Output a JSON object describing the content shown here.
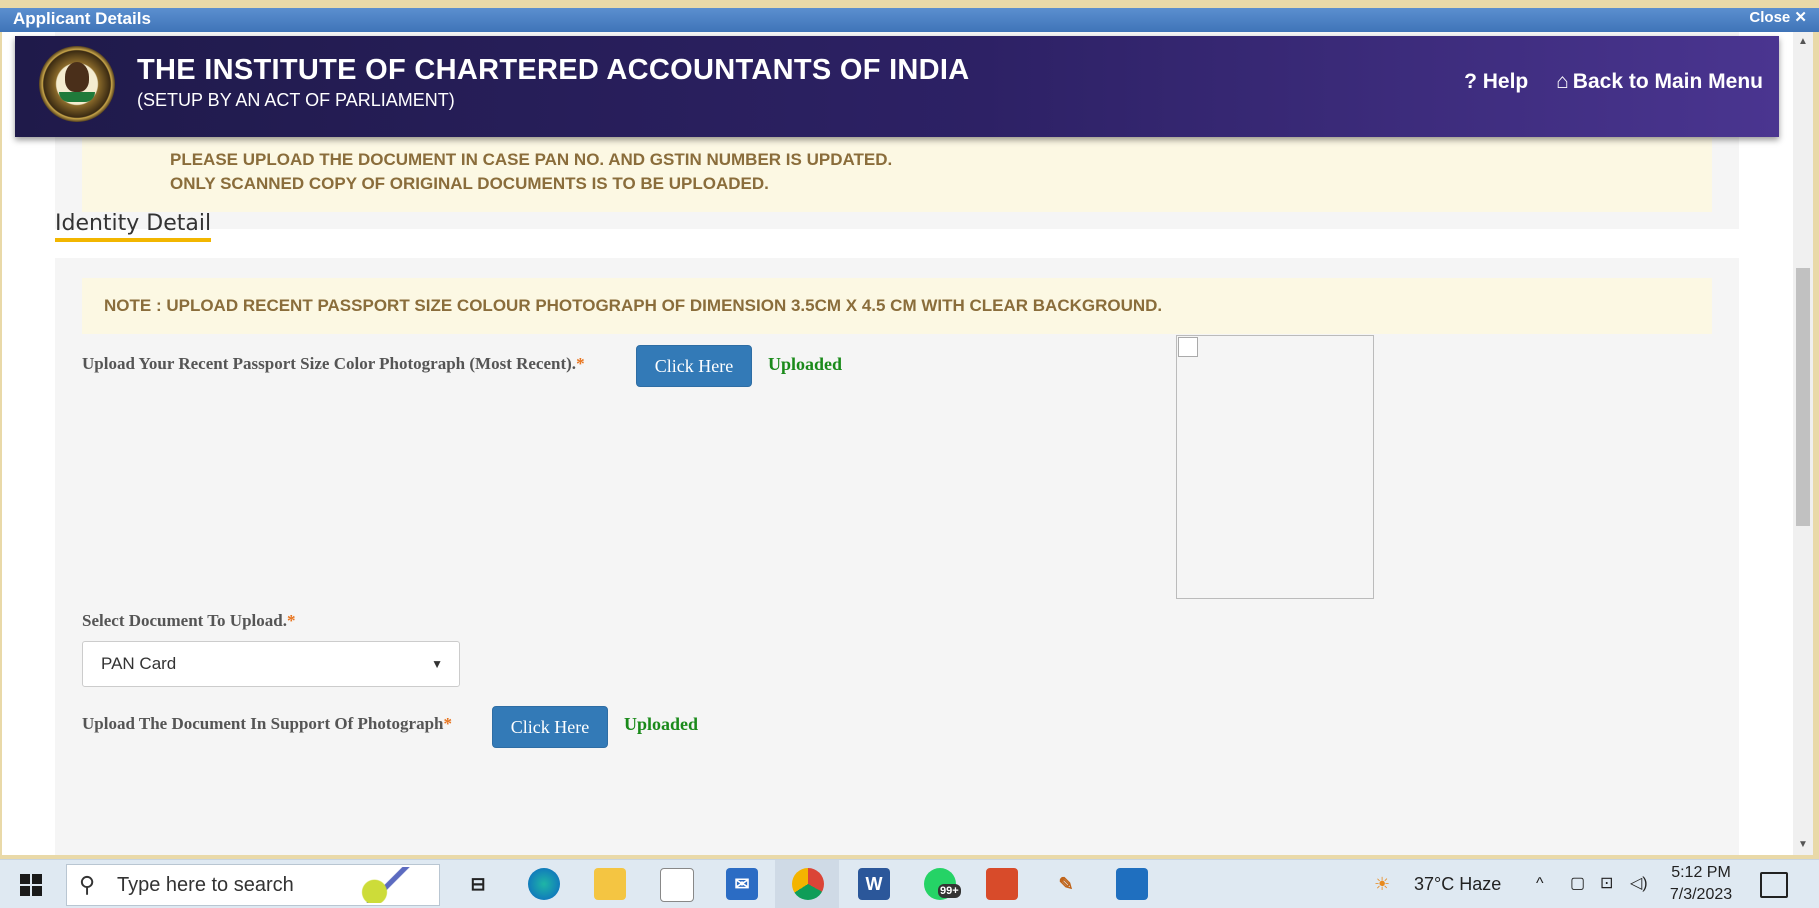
{
  "dialog": {
    "title": "Applicant Details",
    "close_label": "Close ✕"
  },
  "header": {
    "title": "THE INSTITUTE OF CHARTERED ACCOUNTANTS OF INDIA",
    "subtitle": "(SETUP BY AN ACT OF PARLIAMENT)",
    "help_label": "? Help",
    "back_label": "Back to Main Menu",
    "back_icon": "home-icon"
  },
  "top_notice": {
    "line1": "PLEASE UPLOAD THE DOCUMENT IN CASE PAN NO. AND GSTIN NUMBER IS UPDATED.",
    "line2": "ONLY SCANNED COPY OF ORIGINAL DOCUMENTS IS TO BE UPLOADED."
  },
  "identity": {
    "section_title": "Identity Detail",
    "note": "NOTE : UPLOAD RECENT PASSPORT SIZE COLOUR PHOTOGRAPH OF DIMENSION 3.5CM X 4.5 CM WITH CLEAR BACKGROUND.",
    "photo_label": "Upload Your Recent Passport Size Color Photograph (Most Recent).",
    "required_mark": "*",
    "click_here": "Click Here",
    "uploaded": "Uploaded",
    "select_label": "Select Document To Upload.",
    "select_value": "PAN Card",
    "support_label": "Upload The Document In Support Of Photograph"
  },
  "taskbar": {
    "search_placeholder": "Type here to search",
    "weather": "37°C  Haze",
    "time": "5:12 PM",
    "date": "7/3/2023",
    "whatsapp_badge": "99+"
  },
  "colors": {
    "header_purple": "#2d2165",
    "notice_bg": "#fcf8e3",
    "notice_text": "#8a6d3b",
    "button_blue": "#337ab7",
    "uploaded_green": "#1a8a1a",
    "section_underline": "#f2b600"
  }
}
